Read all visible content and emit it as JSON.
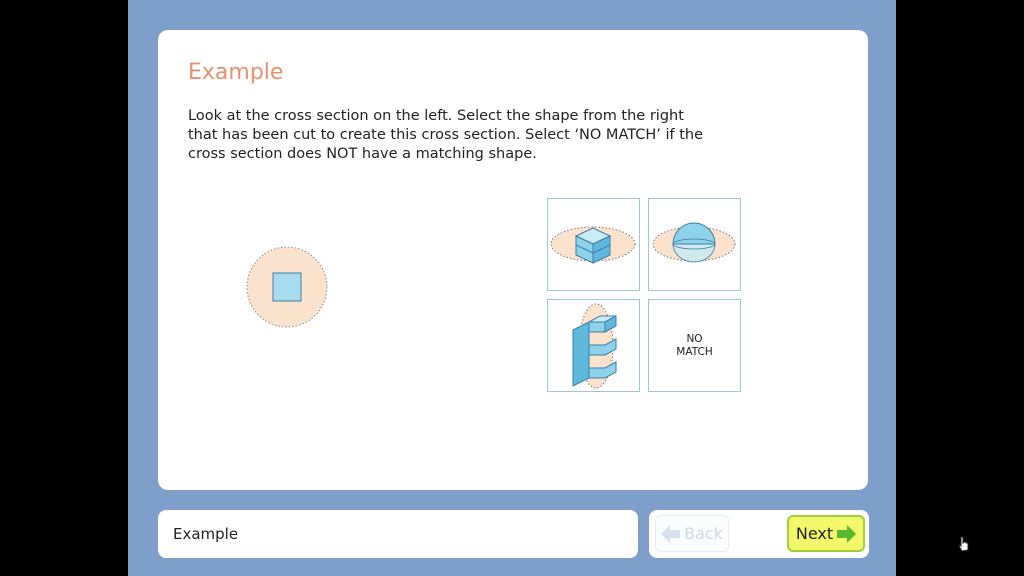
{
  "page": {
    "title": "Example",
    "instructions": [
      "Look at the cross section on the left. Select the shape from the right",
      "that has been cut to create this cross section. Select ‘NO MATCH’ if the",
      "cross section does NOT have a matching shape."
    ]
  },
  "options": {
    "cube": {
      "icon": "cube-on-plane-icon"
    },
    "sphere": {
      "icon": "sphere-on-plane-icon"
    },
    "e_shape": {
      "icon": "e-shape-prism-icon"
    },
    "no_match": {
      "line1": "NO",
      "line2": "MATCH"
    }
  },
  "status_bar": {
    "text": "Example"
  },
  "nav": {
    "back_label": "Back",
    "next_label": "Next",
    "back_enabled": false
  },
  "colors": {
    "frame": "#7f9fcb",
    "title": "#e5906f",
    "shape_fill": "#8fd3ea",
    "plane_fill": "#fbe2cc",
    "next_button": "#f5f76a",
    "next_border": "#9fcf3a"
  }
}
